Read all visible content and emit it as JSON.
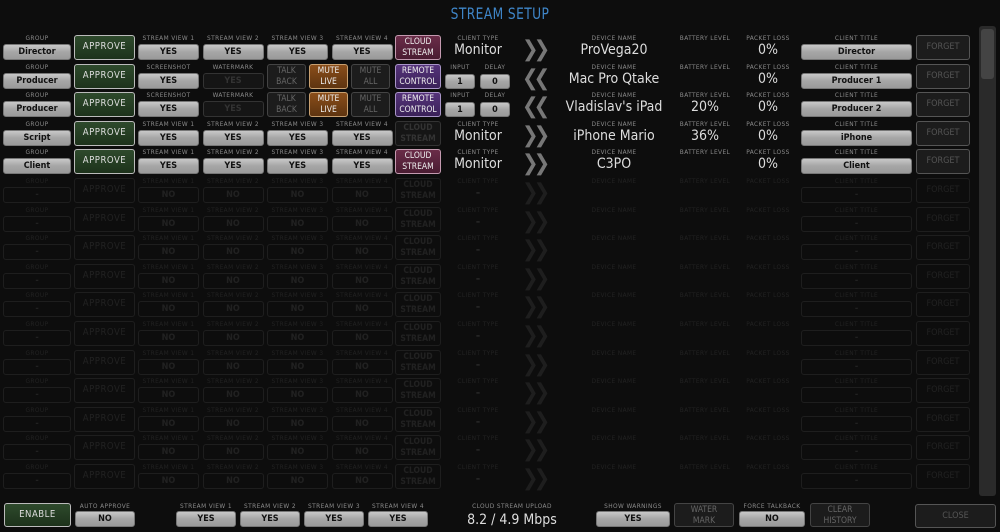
{
  "title": "STREAM SETUP",
  "colors": {
    "title": "#3f86c9",
    "approve": "#2e4a2c",
    "mute_live": "#8a4e1a",
    "remote_control": "#55337a",
    "cloud_stream": "#6a2c48"
  },
  "rows": [
    {
      "group_label": "GROUP",
      "group": "Director",
      "approve": "APPROVE",
      "cells": [
        {
          "label": "STREAM VIEW 1",
          "value": "YES"
        },
        {
          "label": "STREAM VIEW 2",
          "value": "YES"
        },
        {
          "label": "STREAM VIEW 3",
          "value": "YES"
        },
        {
          "label": "STREAM VIEW 4",
          "value": "YES"
        }
      ],
      "cloud": {
        "line1": "CLOUD",
        "line2": "STREAM",
        "state": "on",
        "style": "plum"
      },
      "client": {
        "kind": "type",
        "label": "CLIENT TYPE",
        "value": "Monitor"
      },
      "direction": "chevron-right-icon",
      "device_label": "DEVICE NAME",
      "device": "ProVega20",
      "battery_label": "BATTERY LEVEL",
      "battery": "",
      "loss_label": "PACKET LOSS",
      "loss": "0%",
      "title_label": "CLIENT TITLE",
      "title": "Director",
      "forget": "FORGET"
    },
    {
      "group_label": "GROUP",
      "group": "Producer",
      "approve": "APPROVE",
      "cells": [
        {
          "label": "SCREENSHOT",
          "value": "YES"
        },
        {
          "label": "WATERMARK",
          "value": "YES",
          "state": "dim"
        },
        {
          "toggle": true,
          "line1": "TALK",
          "line2": "BACK",
          "state": "ghost"
        },
        {
          "toggle": true,
          "line1": "MUTE",
          "line2": "LIVE",
          "state": "orange"
        },
        {
          "toggle": true,
          "line1": "MUTE",
          "line2": "ALL",
          "state": "ghost"
        }
      ],
      "cloud": {
        "line1": "REMOTE",
        "line2": "CONTROL",
        "state": "on",
        "style": "purple"
      },
      "client": {
        "kind": "input",
        "input_label": "INPUT",
        "input": "1",
        "delay_label": "DELAY",
        "delay": "0"
      },
      "direction": "chevron-left-icon",
      "device_label": "DEVICE NAME",
      "device": "Mac Pro Qtake",
      "battery_label": "BATTERY LEVEL",
      "battery": "",
      "loss_label": "PACKET LOSS",
      "loss": "0%",
      "title_label": "CLIENT TITLE",
      "title": "Producer 1",
      "forget": "FORGET"
    },
    {
      "group_label": "GROUP",
      "group": "Producer",
      "approve": "APPROVE",
      "cells": [
        {
          "label": "SCREENSHOT",
          "value": "YES"
        },
        {
          "label": "WATERMARK",
          "value": "YES",
          "state": "dim"
        },
        {
          "toggle": true,
          "line1": "TALK",
          "line2": "BACK",
          "state": "ghost"
        },
        {
          "toggle": true,
          "line1": "MUTE",
          "line2": "LIVE",
          "state": "orange"
        },
        {
          "toggle": true,
          "line1": "MUTE",
          "line2": "ALL",
          "state": "ghost"
        }
      ],
      "cloud": {
        "line1": "REMOTE",
        "line2": "CONTROL",
        "state": "on",
        "style": "purple"
      },
      "client": {
        "kind": "input",
        "input_label": "INPUT",
        "input": "1",
        "delay_label": "DELAY",
        "delay": "0"
      },
      "direction": "chevron-left-icon",
      "device_label": "DEVICE NAME",
      "device": "Vladislav's iPad",
      "battery_label": "BATTERY LEVEL",
      "battery": "20%",
      "loss_label": "PACKET LOSS",
      "loss": "0%",
      "title_label": "CLIENT TITLE",
      "title": "Producer 2",
      "forget": "FORGET"
    },
    {
      "group_label": "GROUP",
      "group": "Script",
      "approve": "APPROVE",
      "cells": [
        {
          "label": "STREAM VIEW 1",
          "value": "YES"
        },
        {
          "label": "STREAM VIEW 2",
          "value": "YES"
        },
        {
          "label": "STREAM VIEW 3",
          "value": "YES"
        },
        {
          "label": "STREAM VIEW 4",
          "value": "YES"
        }
      ],
      "cloud": {
        "line1": "CLOUD",
        "line2": "STREAM",
        "state": "off",
        "style": "dim"
      },
      "client": {
        "kind": "type",
        "label": "CLIENT TYPE",
        "value": "Monitor"
      },
      "direction": "chevron-right-icon",
      "device_label": "DEVICE NAME",
      "device": "iPhone Mario",
      "battery_label": "BATTERY LEVEL",
      "battery": "36%",
      "loss_label": "PACKET LOSS",
      "loss": "0%",
      "title_label": "CLIENT TITLE",
      "title": "iPhone",
      "forget": "FORGET"
    },
    {
      "group_label": "GROUP",
      "group": "Client",
      "approve": "APPROVE",
      "cells": [
        {
          "label": "STREAM VIEW 1",
          "value": "YES"
        },
        {
          "label": "STREAM VIEW 2",
          "value": "YES"
        },
        {
          "label": "STREAM VIEW 3",
          "value": "YES"
        },
        {
          "label": "STREAM VIEW 4",
          "value": "YES"
        }
      ],
      "cloud": {
        "line1": "CLOUD",
        "line2": "STREAM",
        "state": "on",
        "style": "plum"
      },
      "client": {
        "kind": "type",
        "label": "CLIENT TYPE",
        "value": "Monitor"
      },
      "direction": "chevron-right-icon",
      "device_label": "DEVICE NAME",
      "device": "C3PO",
      "battery_label": "BATTERY LEVEL",
      "battery": "",
      "loss_label": "PACKET LOSS",
      "loss": "0%",
      "title_label": "CLIENT TITLE",
      "title": "Client",
      "forget": "FORGET"
    }
  ],
  "empty_row": {
    "group_label": "GROUP",
    "group": "-",
    "approve": "APPROVE",
    "cells": [
      {
        "label": "STREAM VIEW 1",
        "value": "NO"
      },
      {
        "label": "STREAM VIEW 2",
        "value": "NO"
      },
      {
        "label": "STREAM VIEW 3",
        "value": "NO"
      },
      {
        "label": "STREAM VIEW 4",
        "value": "NO"
      }
    ],
    "cloud": {
      "line1": "CLOUD",
      "line2": "STREAM",
      "state": "off",
      "style": ""
    },
    "client": {
      "kind": "type",
      "label": "CLIENT TYPE",
      "value": "-"
    },
    "direction": "chevron-right-icon",
    "device_label": "DEVICE NAME",
    "device": "",
    "battery_label": "BATTERY LEVEL",
    "battery": "",
    "loss_label": "PACKET LOSS",
    "loss": "",
    "title_label": "CLIENT TITLE",
    "title": "-",
    "forget": "FORGET"
  },
  "empty_row_count": 11,
  "footer": {
    "enable": "ENABLE",
    "auto_approve_label": "AUTO APPROVE",
    "auto_approve": "NO",
    "stream_views": [
      {
        "label": "STREAM VIEW 1",
        "value": "YES"
      },
      {
        "label": "STREAM VIEW 2",
        "value": "YES"
      },
      {
        "label": "STREAM VIEW 3",
        "value": "YES"
      },
      {
        "label": "STREAM VIEW 4",
        "value": "YES"
      }
    ],
    "upload_label": "CLOUD STREAM UPLOAD",
    "upload": "8.2 / 4.9 Mbps",
    "show_warnings_label": "SHOW WARNINGS",
    "show_warnings": "YES",
    "watermark_line1": "WATER",
    "watermark_line2": "MARK",
    "force_talkback_label": "FORCE TALKBACK",
    "force_talkback": "NO",
    "clear_line1": "CLEAR",
    "clear_line2": "HISTORY",
    "close": "CLOSE"
  }
}
